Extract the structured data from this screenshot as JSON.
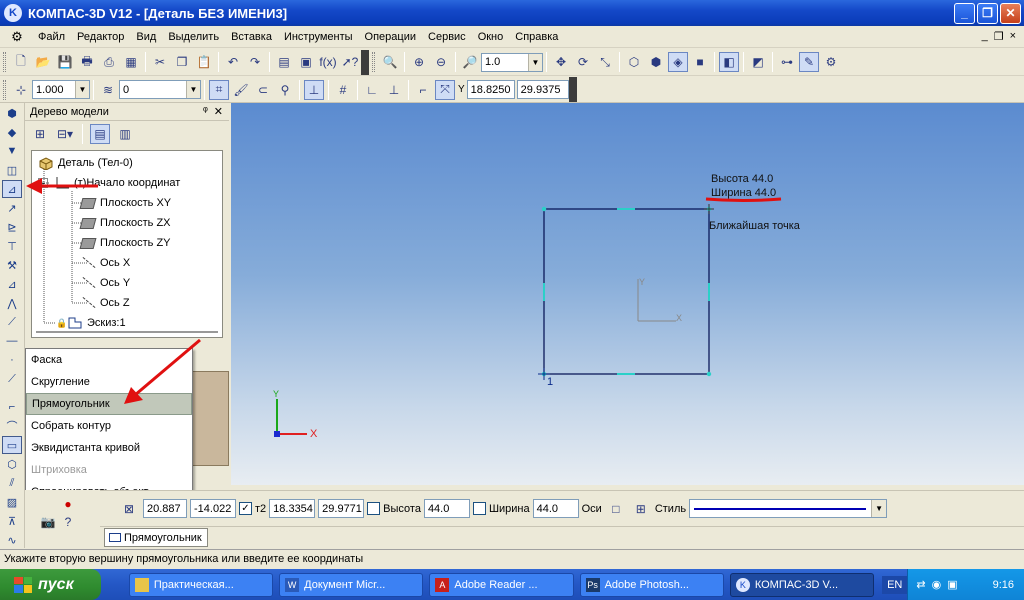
{
  "window": {
    "title": "КОМПАС-3D V12 - [Деталь БЕЗ ИМЕНИ3]",
    "app_icon": "K",
    "buttons": {
      "minimize": "_",
      "maximize": "❐",
      "close": "✕"
    }
  },
  "menu": {
    "items": [
      "Файл",
      "Редактор",
      "Вид",
      "Выделить",
      "Вставка",
      "Инструменты",
      "Операции",
      "Сервис",
      "Окно",
      "Справка"
    ],
    "mdi_buttons": [
      "_",
      "❐",
      "×"
    ]
  },
  "toolbar1": {
    "zoom_value": "1.0"
  },
  "toolbar2": {
    "line_scale": "1.000",
    "layer": "0",
    "coord_label": "Y",
    "coord_x": "18.8250",
    "coord_y": "29.9375"
  },
  "tree": {
    "title": "Дерево модели",
    "header_buttons": [
      "ᵠ",
      "✕"
    ],
    "nodes": [
      "Деталь (Тел-0)",
      "(т)Начало координат",
      "Плоскость XY",
      "Плоскость ZX",
      "Плоскость ZY",
      "Ось X",
      "Ось Y",
      "Ось Z",
      "Эскиз:1"
    ]
  },
  "context_menu": {
    "items": [
      {
        "label": "Фаска",
        "state": "normal"
      },
      {
        "label": "Скругление",
        "state": "normal"
      },
      {
        "label": "Прямоугольник",
        "state": "highlighted"
      },
      {
        "label": "Собрать контур",
        "state": "normal"
      },
      {
        "label": "Эквидистанта кривой",
        "state": "normal"
      },
      {
        "label": "Штриховка",
        "state": "disabled"
      },
      {
        "label": "Спроецировать объект",
        "state": "normal"
      }
    ]
  },
  "canvas": {
    "tooltip_height": "Высота 44.0",
    "tooltip_width": "Ширина 44.0",
    "snap_label": "Ближайшая точка",
    "vertex_label": "1",
    "axis_x": "X",
    "axis_y": "Y"
  },
  "properties": {
    "p1_x": "20.887",
    "p1_y": "-14.022",
    "p2_label": "т2",
    "p2_x": "18.3354",
    "p2_y": "29.9771",
    "height_label": "Высота",
    "height_value": "44.0",
    "width_label": "Ширина",
    "width_value": "44.0",
    "axes_label": "Оси",
    "style_label": "Стиль"
  },
  "tab": {
    "label": "Прямоугольник"
  },
  "status": {
    "text": "Укажите вторую вершину прямоугольника или введите ее координаты"
  },
  "taskbar": {
    "start": "пуск",
    "tasks": [
      "Практическая...",
      "Документ Micr...",
      "Adobe Reader ...",
      "Adobe Photosh...",
      "КОМПАС-3D V..."
    ],
    "lang": "EN",
    "clock": "9:16"
  },
  "colors": {
    "annotation_arrow": "#e01010",
    "sketch_line": "#0c1a5a",
    "title_bar": "#1448c8"
  }
}
